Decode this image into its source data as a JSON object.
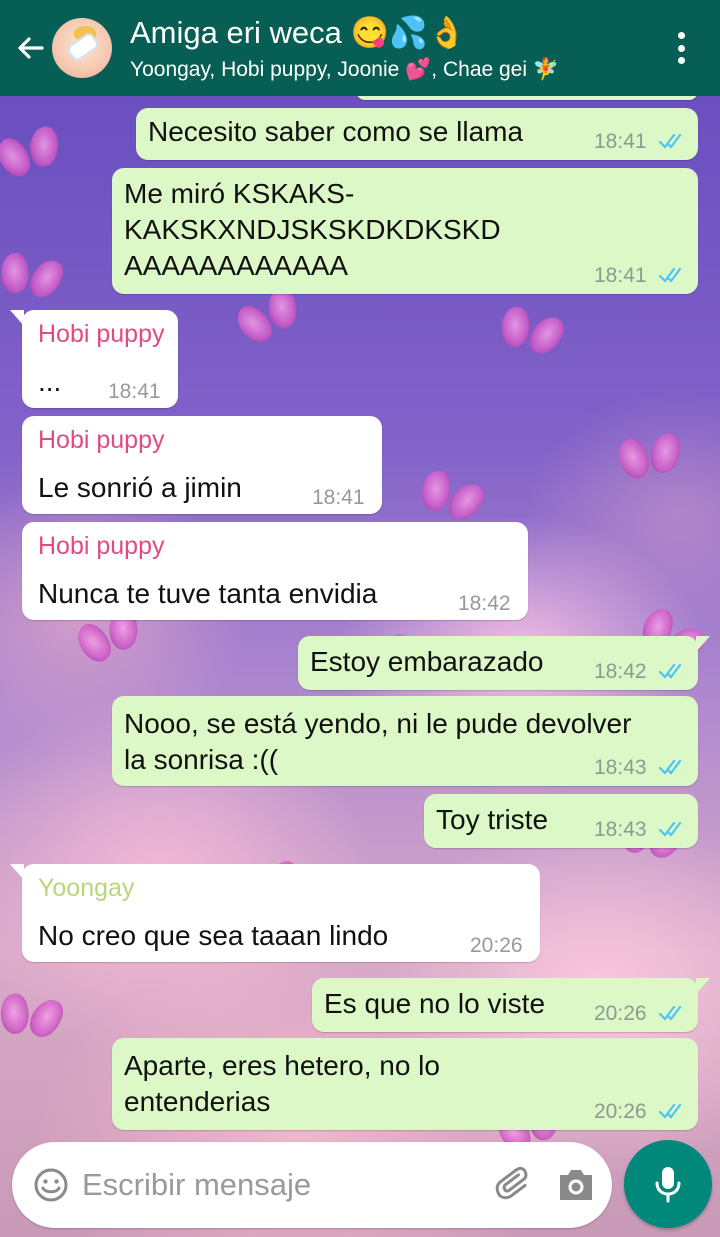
{
  "header": {
    "title": "Amiga eri weca 😋💦👌",
    "subtitle": "Yoongay, Hobi puppy, Joonie 💕, Chae gei 🧚"
  },
  "colors": {
    "header": "#075e54",
    "outgoing_bubble": "#dcf8c6",
    "incoming_bubble": "#ffffff",
    "hobi_name": "#e04b82",
    "yoongay_name": "#b8d67a",
    "read_ticks": "#4fc3f7",
    "mic_button": "#00897b"
  },
  "messages": [
    {
      "text": "Necesito saber como se llama",
      "time": "18:41"
    },
    {
      "text_lines": [
        "Me miró KSKAKS-",
        "KAKSKXNDJSKSKDKDKSKD",
        "AAAAAAAAAAAA"
      ],
      "time": "18:41"
    },
    {
      "sender": "Hobi puppy",
      "text": "...",
      "time": "18:41"
    },
    {
      "sender": "Hobi puppy",
      "text": "Le sonrió a jimin",
      "time": "18:41"
    },
    {
      "sender": "Hobi puppy",
      "text": "Nunca te tuve tanta envidia",
      "time": "18:42"
    },
    {
      "text": "Estoy embarazado",
      "time": "18:42"
    },
    {
      "text_lines": [
        "Nooo, se está yendo, ni le pude devolver",
        "la sonrisa :(("
      ],
      "time": "18:43"
    },
    {
      "text": "Toy triste",
      "time": "18:43"
    },
    {
      "sender": "Yoongay",
      "text": "No creo que sea taaan lindo",
      "time": "20:26"
    },
    {
      "text": "Es que no lo viste",
      "time": "20:26"
    },
    {
      "text_lines": [
        "Aparte, eres hetero, no lo",
        "entenderias"
      ],
      "time": "20:26"
    }
  ],
  "composer": {
    "placeholder": "Escribir mensaje"
  },
  "icons": [
    "back-arrow-icon",
    "group-avatar",
    "more-options-icon",
    "double-check-icon",
    "emoji-icon",
    "attach-icon",
    "camera-icon",
    "mic-icon"
  ]
}
